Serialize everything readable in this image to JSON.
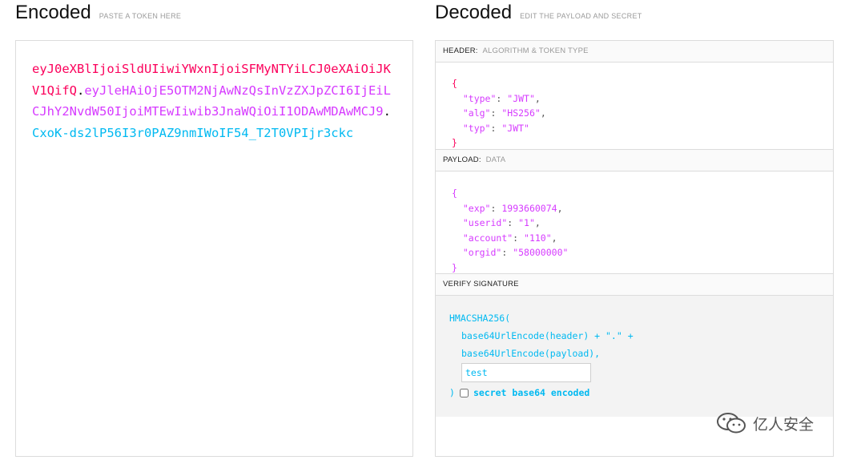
{
  "encoded": {
    "title": "Encoded",
    "subtitle": "PASTE A TOKEN HERE",
    "token": {
      "header": "eyJ0eXBlIjoiSldUIiwiYWxnIjoiSFMyNTYiLCJ0eXAiOiJKV1QifQ",
      "payload": "eyJleHAiOjE5OTM2NjAwNzQsInVzZXJpZCI6IjEiLCJhY2NvdW50IjoiMTEwIiwib3JnaWQiOiI1ODAwMDAwMCJ9",
      "signature": "CxoK-ds2lP56I3r0PAZ9nmIWoIF54_T2T0VPIjr3ckc",
      "dot": "."
    }
  },
  "decoded": {
    "title": "Decoded",
    "subtitle": "EDIT THE PAYLOAD AND SECRET",
    "header_section": {
      "label": "HEADER:",
      "sublabel": "ALGORITHM & TOKEN TYPE"
    },
    "header_json": [
      {
        "key": "\"type\"",
        "value": "\"JWT\"",
        "comma": ","
      },
      {
        "key": "\"alg\"",
        "value": "\"HS256\"",
        "comma": ","
      },
      {
        "key": "\"typ\"",
        "value": "\"JWT\"",
        "comma": ""
      }
    ],
    "payload_section": {
      "label": "PAYLOAD:",
      "sublabel": "DATA"
    },
    "payload_json": [
      {
        "key": "\"exp\"",
        "value": "1993660074",
        "comma": ","
      },
      {
        "key": "\"userid\"",
        "value": "\"1\"",
        "comma": ","
      },
      {
        "key": "\"account\"",
        "value": "\"110\"",
        "comma": ","
      },
      {
        "key": "\"orgid\"",
        "value": "\"58000000\"",
        "comma": ""
      }
    ],
    "brace_open": "{",
    "brace_close": "}",
    "verify_section": {
      "label": "VERIFY SIGNATURE"
    },
    "verify": {
      "line1": "HMACSHA256(",
      "line2": "base64UrlEncode(header) + \".\" +",
      "line3": "base64UrlEncode(payload),",
      "secret_value": "test",
      "close_paren": ")",
      "b64_label": "secret base64 encoded"
    }
  },
  "watermark": {
    "text": "亿人安全",
    "icon": "wechat-icon"
  },
  "colors": {
    "header_red": "#fb015b",
    "payload_purple": "#d63aff",
    "signature_blue": "#00b9f1"
  }
}
